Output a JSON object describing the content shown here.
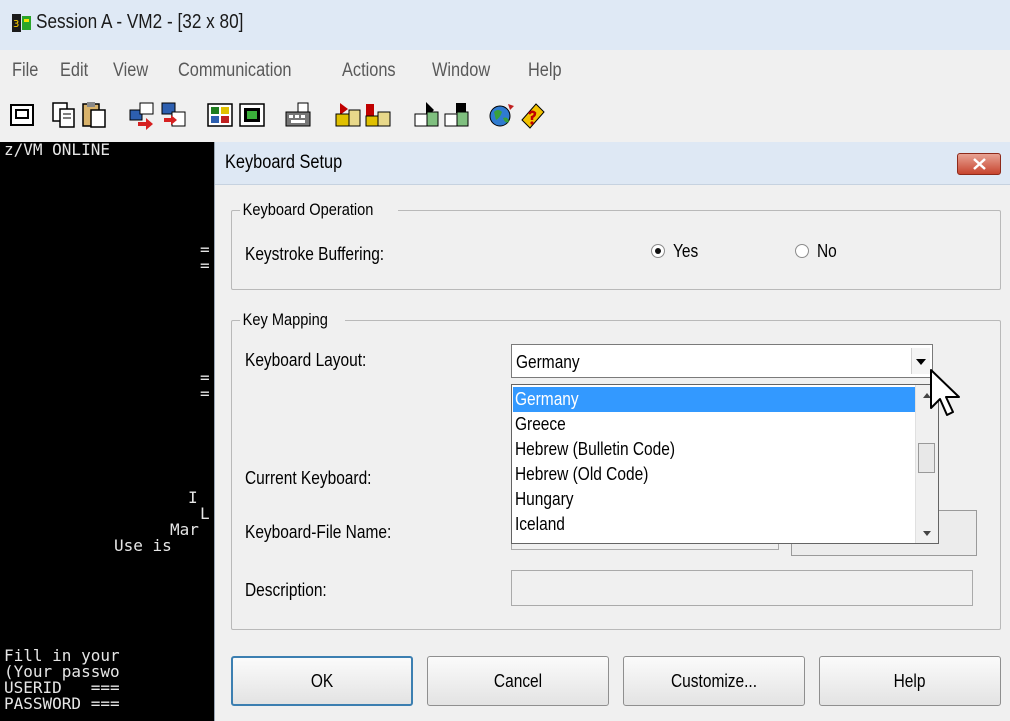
{
  "window": {
    "title": "Session A - VM2 - [32 x 80]",
    "menu": [
      "File",
      "Edit",
      "View",
      "Communication",
      "Actions",
      "Window",
      "Help"
    ]
  },
  "toolbar": {
    "icons": [
      "display-icon",
      "copy-icon",
      "paste-icon",
      "send-icon",
      "receive-icon",
      "color-icon",
      "print-icon",
      "keyboard-icon",
      "macro-record-icon",
      "macro-play-icon",
      "transfer-icon",
      "transfer-alt-icon",
      "globe-icon",
      "help-icon"
    ]
  },
  "terminal": {
    "lines": [
      "z/VM ONLINE",
      "=",
      "=",
      "=",
      "=",
      "I",
      "L",
      "Mar",
      "Use is",
      "Fill in your",
      "(Your passwo",
      "USERID   ===",
      "PASSWORD ==="
    ]
  },
  "dialog": {
    "title": "Keyboard Setup",
    "keyboard_operation": {
      "legend": "Keyboard Operation",
      "label": "Keystroke Buffering:",
      "yes": "Yes",
      "no": "No",
      "selected": "Yes"
    },
    "key_mapping": {
      "legend": "Key Mapping",
      "layout_label": "Keyboard Layout:",
      "layout_value": "Germany",
      "options": [
        "Germany",
        "Greece",
        "Hebrew (Bulletin Code)",
        "Hebrew (Old Code)",
        "Hungary",
        "Iceland"
      ],
      "current_label": "Current Keyboard:",
      "file_label": "Keyboard-File Name:",
      "description_label": "Description:"
    },
    "buttons": {
      "ok": "OK",
      "cancel": "Cancel",
      "customize": "Customize...",
      "help": "Help"
    }
  }
}
